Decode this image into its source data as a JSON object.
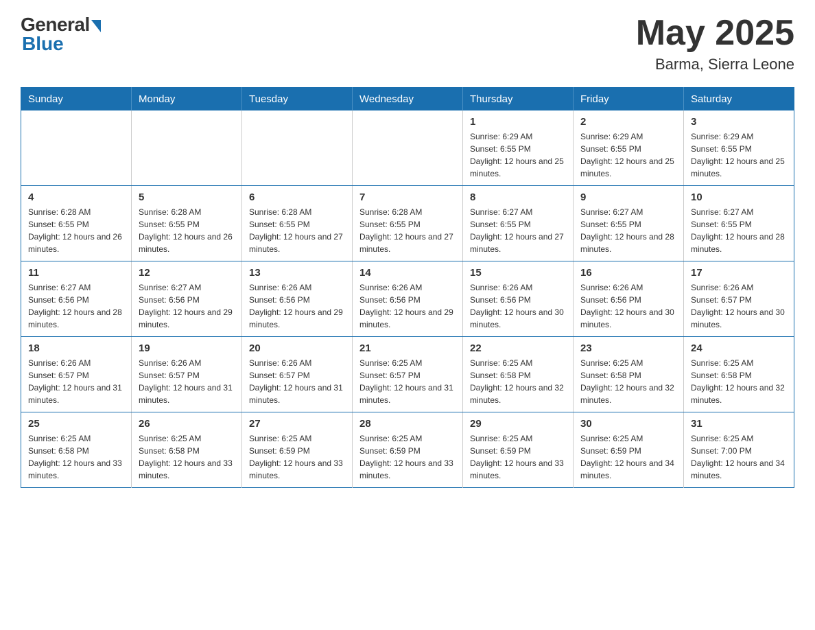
{
  "header": {
    "logo": {
      "general": "General",
      "blue": "Blue"
    },
    "title": "May 2025",
    "location": "Barma, Sierra Leone"
  },
  "calendar": {
    "days_of_week": [
      "Sunday",
      "Monday",
      "Tuesday",
      "Wednesday",
      "Thursday",
      "Friday",
      "Saturday"
    ],
    "weeks": [
      [
        {
          "day": "",
          "info": ""
        },
        {
          "day": "",
          "info": ""
        },
        {
          "day": "",
          "info": ""
        },
        {
          "day": "",
          "info": ""
        },
        {
          "day": "1",
          "info": "Sunrise: 6:29 AM\nSunset: 6:55 PM\nDaylight: 12 hours and 25 minutes."
        },
        {
          "day": "2",
          "info": "Sunrise: 6:29 AM\nSunset: 6:55 PM\nDaylight: 12 hours and 25 minutes."
        },
        {
          "day": "3",
          "info": "Sunrise: 6:29 AM\nSunset: 6:55 PM\nDaylight: 12 hours and 25 minutes."
        }
      ],
      [
        {
          "day": "4",
          "info": "Sunrise: 6:28 AM\nSunset: 6:55 PM\nDaylight: 12 hours and 26 minutes."
        },
        {
          "day": "5",
          "info": "Sunrise: 6:28 AM\nSunset: 6:55 PM\nDaylight: 12 hours and 26 minutes."
        },
        {
          "day": "6",
          "info": "Sunrise: 6:28 AM\nSunset: 6:55 PM\nDaylight: 12 hours and 27 minutes."
        },
        {
          "day": "7",
          "info": "Sunrise: 6:28 AM\nSunset: 6:55 PM\nDaylight: 12 hours and 27 minutes."
        },
        {
          "day": "8",
          "info": "Sunrise: 6:27 AM\nSunset: 6:55 PM\nDaylight: 12 hours and 27 minutes."
        },
        {
          "day": "9",
          "info": "Sunrise: 6:27 AM\nSunset: 6:55 PM\nDaylight: 12 hours and 28 minutes."
        },
        {
          "day": "10",
          "info": "Sunrise: 6:27 AM\nSunset: 6:55 PM\nDaylight: 12 hours and 28 minutes."
        }
      ],
      [
        {
          "day": "11",
          "info": "Sunrise: 6:27 AM\nSunset: 6:56 PM\nDaylight: 12 hours and 28 minutes."
        },
        {
          "day": "12",
          "info": "Sunrise: 6:27 AM\nSunset: 6:56 PM\nDaylight: 12 hours and 29 minutes."
        },
        {
          "day": "13",
          "info": "Sunrise: 6:26 AM\nSunset: 6:56 PM\nDaylight: 12 hours and 29 minutes."
        },
        {
          "day": "14",
          "info": "Sunrise: 6:26 AM\nSunset: 6:56 PM\nDaylight: 12 hours and 29 minutes."
        },
        {
          "day": "15",
          "info": "Sunrise: 6:26 AM\nSunset: 6:56 PM\nDaylight: 12 hours and 30 minutes."
        },
        {
          "day": "16",
          "info": "Sunrise: 6:26 AM\nSunset: 6:56 PM\nDaylight: 12 hours and 30 minutes."
        },
        {
          "day": "17",
          "info": "Sunrise: 6:26 AM\nSunset: 6:57 PM\nDaylight: 12 hours and 30 minutes."
        }
      ],
      [
        {
          "day": "18",
          "info": "Sunrise: 6:26 AM\nSunset: 6:57 PM\nDaylight: 12 hours and 31 minutes."
        },
        {
          "day": "19",
          "info": "Sunrise: 6:26 AM\nSunset: 6:57 PM\nDaylight: 12 hours and 31 minutes."
        },
        {
          "day": "20",
          "info": "Sunrise: 6:26 AM\nSunset: 6:57 PM\nDaylight: 12 hours and 31 minutes."
        },
        {
          "day": "21",
          "info": "Sunrise: 6:25 AM\nSunset: 6:57 PM\nDaylight: 12 hours and 31 minutes."
        },
        {
          "day": "22",
          "info": "Sunrise: 6:25 AM\nSunset: 6:58 PM\nDaylight: 12 hours and 32 minutes."
        },
        {
          "day": "23",
          "info": "Sunrise: 6:25 AM\nSunset: 6:58 PM\nDaylight: 12 hours and 32 minutes."
        },
        {
          "day": "24",
          "info": "Sunrise: 6:25 AM\nSunset: 6:58 PM\nDaylight: 12 hours and 32 minutes."
        }
      ],
      [
        {
          "day": "25",
          "info": "Sunrise: 6:25 AM\nSunset: 6:58 PM\nDaylight: 12 hours and 33 minutes."
        },
        {
          "day": "26",
          "info": "Sunrise: 6:25 AM\nSunset: 6:58 PM\nDaylight: 12 hours and 33 minutes."
        },
        {
          "day": "27",
          "info": "Sunrise: 6:25 AM\nSunset: 6:59 PM\nDaylight: 12 hours and 33 minutes."
        },
        {
          "day": "28",
          "info": "Sunrise: 6:25 AM\nSunset: 6:59 PM\nDaylight: 12 hours and 33 minutes."
        },
        {
          "day": "29",
          "info": "Sunrise: 6:25 AM\nSunset: 6:59 PM\nDaylight: 12 hours and 33 minutes."
        },
        {
          "day": "30",
          "info": "Sunrise: 6:25 AM\nSunset: 6:59 PM\nDaylight: 12 hours and 34 minutes."
        },
        {
          "day": "31",
          "info": "Sunrise: 6:25 AM\nSunset: 7:00 PM\nDaylight: 12 hours and 34 minutes."
        }
      ]
    ]
  }
}
